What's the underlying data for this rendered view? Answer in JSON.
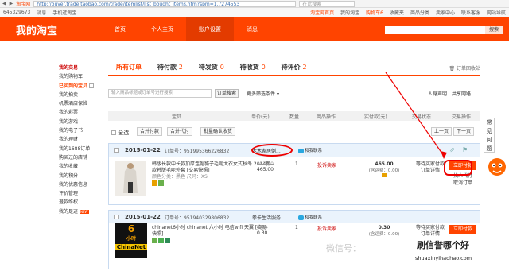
{
  "browser": {
    "url": "http://buyer.trade.taobao.com/trade/itemlist/list_bought_items.htm?spm=1.7274553",
    "search_placeholder": "在此搜索",
    "tab_label": "淘宝网"
  },
  "topbar": {
    "user": "645329673",
    "messages": "消息",
    "mobile": "手机逛淘宝",
    "right_links": [
      "淘宝网首页",
      "我的淘宝",
      "购物车6",
      "收藏夹",
      "商品分类",
      "卖家中心",
      "联系客服",
      "网站导航"
    ]
  },
  "header": {
    "logo": "我的淘宝",
    "nav": [
      "首页",
      "个人主页",
      "账户设置",
      "消息"
    ],
    "search_button": "搜索"
  },
  "sidebar": {
    "items": [
      "我的交易",
      "我的购物车",
      "已买到的宝贝",
      "我的拍卖",
      "机票酒店保险",
      "我的彩票",
      "我的游戏",
      "我的电子书",
      "我的理财",
      "我的1688订单",
      "购买过的店铺",
      "我的收藏",
      "我的积分",
      "我的优惠信息",
      "评价管理",
      "退款维权",
      "我的足迹"
    ],
    "new_badge": "NEW"
  },
  "tabs": {
    "items": [
      {
        "label": "所有订单",
        "count": ""
      },
      {
        "label": "待付款",
        "count": "2"
      },
      {
        "label": "待发货",
        "count": "0"
      },
      {
        "label": "待收货",
        "count": "0"
      },
      {
        "label": "待评价",
        "count": "2"
      }
    ],
    "trash": "订单回收站"
  },
  "filters": {
    "search_placeholder": "输入商品标题或订单号进行搜索",
    "search_button": "订单搜索",
    "more": "更多筛选条件",
    "new_feature": "人身声明　共享网路"
  },
  "columns": [
    "宝贝",
    "单价(元)",
    "数量",
    "商品操作",
    "实付款(元)",
    "交易状态",
    "交易操作"
  ],
  "toolbar": {
    "select_all": "全选",
    "merge_pay": "合并付款",
    "merge_ship": "合并代付",
    "batch_confirm": "批量确认收货",
    "prev": "上一页",
    "next": "下一页"
  },
  "orders": [
    {
      "date": "2015-01-22",
      "order_no": "订单号：951995366226832",
      "shop": "木木家居倒...",
      "wangwang": "和我联系",
      "title": "韩版长款中长款加厚连帽貉子毛呢大衣女式秋冬 2014新款韩版毛呢外套 [交易快照]",
      "attrs": "颜色分类：黑色  尺码：XS",
      "old_price": "957.00",
      "price": "465.00",
      "qty": "1",
      "op": "投诉卖家",
      "total": "465.00",
      "total_note": "(含运费：0.00)",
      "status": "等待买家付款",
      "status_link": "订单详情",
      "pay": "立即付款",
      "alt1": "找人代付",
      "alt2": "取消订单"
    },
    {
      "date": "2015-01-22",
      "order_no": "订单号：951940329806832",
      "shop": "拳卡生活服务",
      "wangwang": "和我联系",
      "title": "chinanet6小时 chinanet 六小时 电信wifi 天翼 [交易快照]",
      "attrs": "",
      "old_price": "0.50",
      "price": "0.30",
      "qty": "1",
      "op": "投诉卖家",
      "total": "0.30",
      "total_note": "(含运费：0.00)",
      "status": "等待买家付款",
      "status_link": "订单详情",
      "pay": "立即付款",
      "logo_top": "6",
      "logo_mid": "小时",
      "logo_bottom": "ChinaNet"
    }
  ],
  "side_widget": [
    "常",
    "见",
    "问",
    "题"
  ],
  "watermark": {
    "wechat": "微信号：",
    "title": "刷信誉哪个好",
    "url": "shuaxinyihaohao.com"
  }
}
